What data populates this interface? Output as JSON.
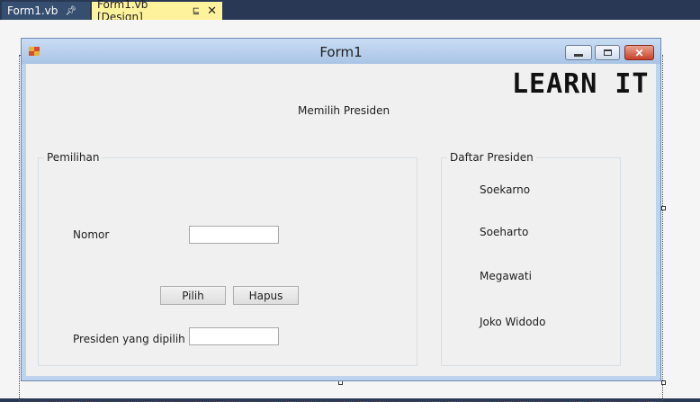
{
  "tabs": [
    {
      "label": "Form1.vb",
      "pin_icon": "pin-icon"
    },
    {
      "label": "Form1.vb [Design]",
      "pin_icon": "pin-icon",
      "close_icon": "close-icon"
    }
  ],
  "form": {
    "title": "Form1",
    "logo_text": "LEARN IT",
    "heading": "Memilih Presiden",
    "group_selection": {
      "caption": "Pemilihan",
      "number_label": "Nomor",
      "number_value": "",
      "pick_button": "Pilih",
      "clear_button": "Hapus",
      "result_label": "Presiden yang dipilih",
      "result_value": ""
    },
    "group_list": {
      "caption": "Daftar Presiden",
      "items": [
        "Soekarno",
        "Soeharto",
        "Megawati",
        "Joko Widodo"
      ]
    }
  },
  "colors": {
    "ide_background": "#293955",
    "active_tab": "#fff29d",
    "window_frame": "#bdd3ee",
    "form_background": "#f0f0f0"
  }
}
